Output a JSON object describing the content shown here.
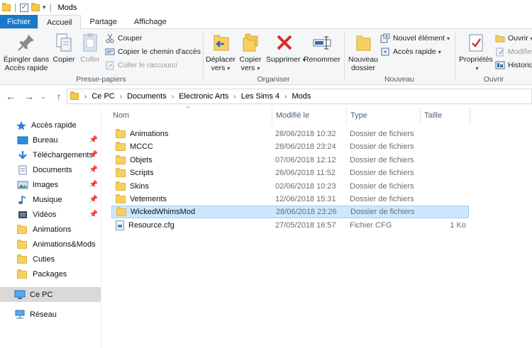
{
  "window": {
    "title": "Mods"
  },
  "ribbon_tabs": [
    {
      "label": "Fichier"
    },
    {
      "label": "Accueil"
    },
    {
      "label": "Partage"
    },
    {
      "label": "Affichage"
    }
  ],
  "ribbon": {
    "clipboard": {
      "label": "Presse-papiers",
      "pin_line1": "Épingler dans",
      "pin_line2": "Accès rapide",
      "copy": "Copier",
      "paste": "Coller",
      "cut": "Couper",
      "copy_path": "Copier le chemin d'accès",
      "paste_shortcut": "Coller le raccourci"
    },
    "organize": {
      "label": "Organiser",
      "move_line1": "Déplacer",
      "move_line2": "vers",
      "copy_line1": "Copier",
      "copy_line2": "vers",
      "delete": "Supprimer",
      "rename": "Renommer"
    },
    "new": {
      "label": "Nouveau",
      "new_folder_line1": "Nouveau",
      "new_folder_line2": "dossier",
      "new_item": "Nouvel élément",
      "easy_access": "Accès rapide"
    },
    "open": {
      "label": "Ouvrir",
      "properties": "Propriétés",
      "open": "Ouvrir",
      "edit": "Modifier",
      "history": "Historique"
    }
  },
  "address": {
    "crumbs": [
      "Ce PC",
      "Documents",
      "Electronic Arts",
      "Les Sims 4",
      "Mods"
    ]
  },
  "sidebar": {
    "quick_access": "Accès rapide",
    "items": [
      {
        "label": "Bureau",
        "pinned": true,
        "icon": "desktop-icon"
      },
      {
        "label": "Téléchargements",
        "pinned": true,
        "icon": "download-icon"
      },
      {
        "label": "Documents",
        "pinned": true,
        "icon": "documents-icon"
      },
      {
        "label": "Images",
        "pinned": true,
        "icon": "images-icon"
      },
      {
        "label": "Musique",
        "pinned": true,
        "icon": "music-icon"
      },
      {
        "label": "Vidéos",
        "pinned": true,
        "icon": "videos-icon"
      },
      {
        "label": "Animations",
        "pinned": false,
        "icon": "folder-icon"
      },
      {
        "label": "Animations&Mods",
        "pinned": false,
        "icon": "folder-icon"
      },
      {
        "label": "Cuties",
        "pinned": false,
        "icon": "folder-icon"
      },
      {
        "label": "Packages",
        "pinned": false,
        "icon": "folder-icon"
      }
    ],
    "this_pc": "Ce PC",
    "network": "Réseau"
  },
  "filelist": {
    "columns": {
      "name": "Nom",
      "modified": "Modifié le",
      "type": "Type",
      "size": "Taille"
    },
    "rows": [
      {
        "name": "Animations",
        "modified": "28/06/2018 10:32",
        "type": "Dossier de fichiers",
        "size": ""
      },
      {
        "name": "MCCC",
        "modified": "28/06/2018 23:24",
        "type": "Dossier de fichiers",
        "size": ""
      },
      {
        "name": "Objets",
        "modified": "07/06/2018 12:12",
        "type": "Dossier de fichiers",
        "size": ""
      },
      {
        "name": "Scripts",
        "modified": "26/06/2018 11:52",
        "type": "Dossier de fichiers",
        "size": ""
      },
      {
        "name": "Skins",
        "modified": "02/06/2018 10:23",
        "type": "Dossier de fichiers",
        "size": ""
      },
      {
        "name": "Vetements",
        "modified": "12/06/2018 15:31",
        "type": "Dossier de fichiers",
        "size": ""
      },
      {
        "name": "WickedWhimsMod",
        "modified": "28/06/2018 23:26",
        "type": "Dossier de fichiers",
        "size": "",
        "selected": true
      },
      {
        "name": "Resource.cfg",
        "modified": "27/05/2018 16:57",
        "type": "Fichier CFG",
        "size": "1 Ko"
      }
    ]
  },
  "colors": {
    "accent": "#1979ca",
    "selection": "#cce8ff",
    "folder": "#f8d061"
  }
}
